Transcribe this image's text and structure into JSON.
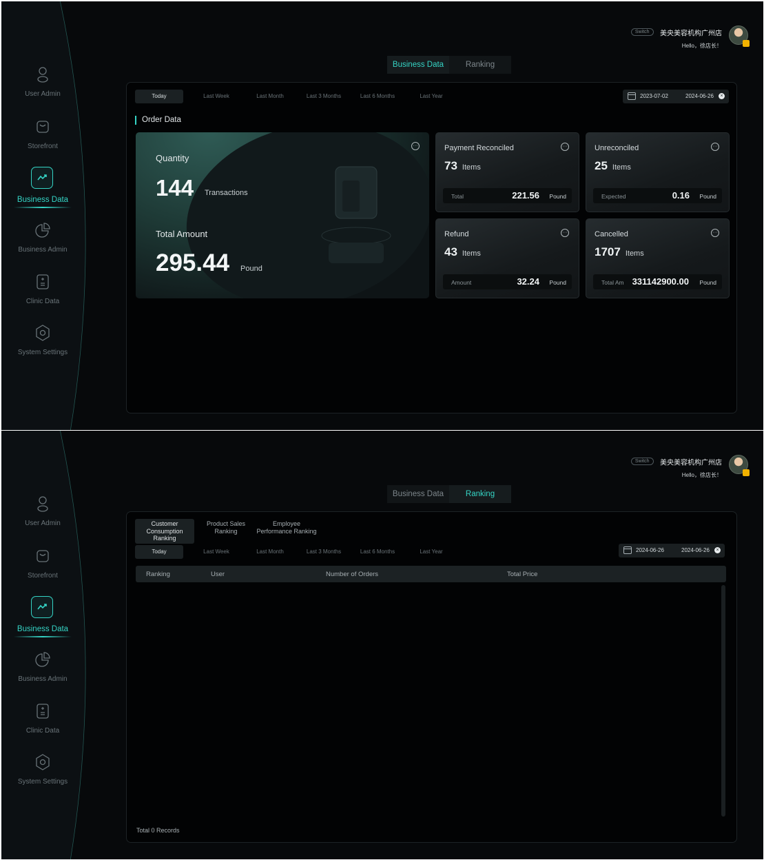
{
  "nav": {
    "items": [
      {
        "label": "User Admin",
        "icon": "user-icon"
      },
      {
        "label": "Storefront",
        "icon": "bag-icon"
      },
      {
        "label": "Business Data",
        "icon": "trend-chart-icon"
      },
      {
        "label": "Business Admin",
        "icon": "pie-chart-icon"
      },
      {
        "label": "Clinic Data",
        "icon": "calculator-icon"
      },
      {
        "label": "System Settings",
        "icon": "hexagon-settings-icon"
      }
    ],
    "active": "Business Data"
  },
  "header": {
    "switch_label": "Switch",
    "store_name": "美央美容机构广州店",
    "greeting": "Hello，徐店长！"
  },
  "top_tabs": [
    "Business Data",
    "Ranking"
  ],
  "time_ranges": [
    "Today",
    "Last Week",
    "Last Month",
    "Last 3 Months",
    "Last 6 Months",
    "Last Year"
  ],
  "business_view": {
    "active_tab": "Business Data",
    "date_start": "2023-07-02",
    "date_end": "2024-06-26",
    "section_title": "Order Data",
    "quantity": {
      "label": "Quantity",
      "value": "144",
      "unit": "Transactions"
    },
    "total_amount": {
      "label": "Total Amount",
      "value": "295.44",
      "unit": "Pound"
    },
    "cards": [
      {
        "title": "Payment Reconciled",
        "count": "73",
        "count_unit": "Items",
        "foot_label": "Total",
        "foot_value": "221.56",
        "foot_unit": "Pound"
      },
      {
        "title": "Unreconciled",
        "count": "25",
        "count_unit": "Items",
        "foot_label": "Expected",
        "foot_value": "0.16",
        "foot_unit": "Pound"
      },
      {
        "title": "Refund",
        "count": "43",
        "count_unit": "Items",
        "foot_label": "Amount",
        "foot_value": "32.24",
        "foot_unit": "Pound"
      },
      {
        "title": "Cancelled",
        "count": "1707",
        "count_unit": "Items",
        "foot_label": "Total Am",
        "foot_value": "331142900.00",
        "foot_unit": "Pound"
      }
    ]
  },
  "ranking_view": {
    "active_tab": "Ranking",
    "sub_tabs": [
      "Customer Consumption Ranking",
      "Product Sales Ranking",
      "Employee Performance Ranking"
    ],
    "date_start": "2024-06-26",
    "date_end": "2024-06-26",
    "columns": [
      "Ranking",
      "User",
      "Number of Orders",
      "Total Price"
    ],
    "total_records": "Total 0 Records"
  },
  "colors": {
    "accent": "#35d5c6",
    "background": "#07090b",
    "panel": "#020304"
  }
}
